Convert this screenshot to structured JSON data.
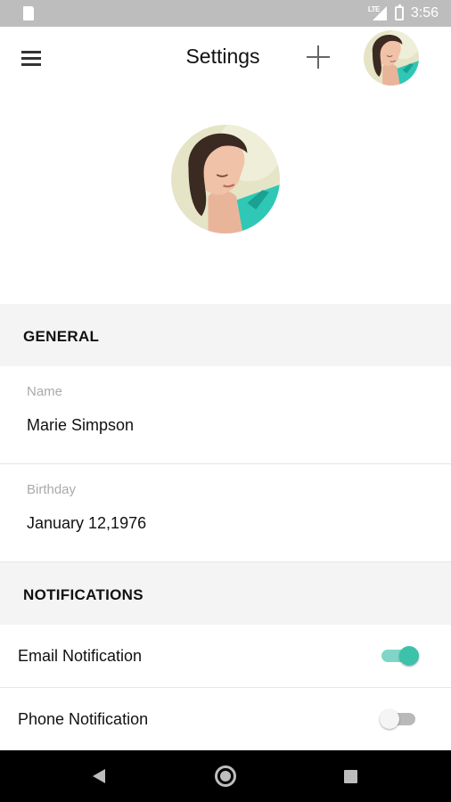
{
  "status_bar": {
    "network": "LTE",
    "time": "3:56"
  },
  "app_bar": {
    "title": "Settings"
  },
  "profile": {
    "avatar_icon": "profile-photo"
  },
  "general": {
    "header": "GENERAL",
    "fields": [
      {
        "label": "Name",
        "value": "Marie Simpson"
      },
      {
        "label": "Birthday",
        "value": "January 12,1976"
      }
    ]
  },
  "notifications": {
    "header": "NOTIFICATIONS",
    "toggles": [
      {
        "label": "Email Notification",
        "on": true
      },
      {
        "label": "Phone Notification",
        "on": false
      }
    ]
  },
  "colors": {
    "accent": "#3cc2aa",
    "section_bg": "#f4f4f4",
    "status_bar": "#bdbdbd"
  }
}
